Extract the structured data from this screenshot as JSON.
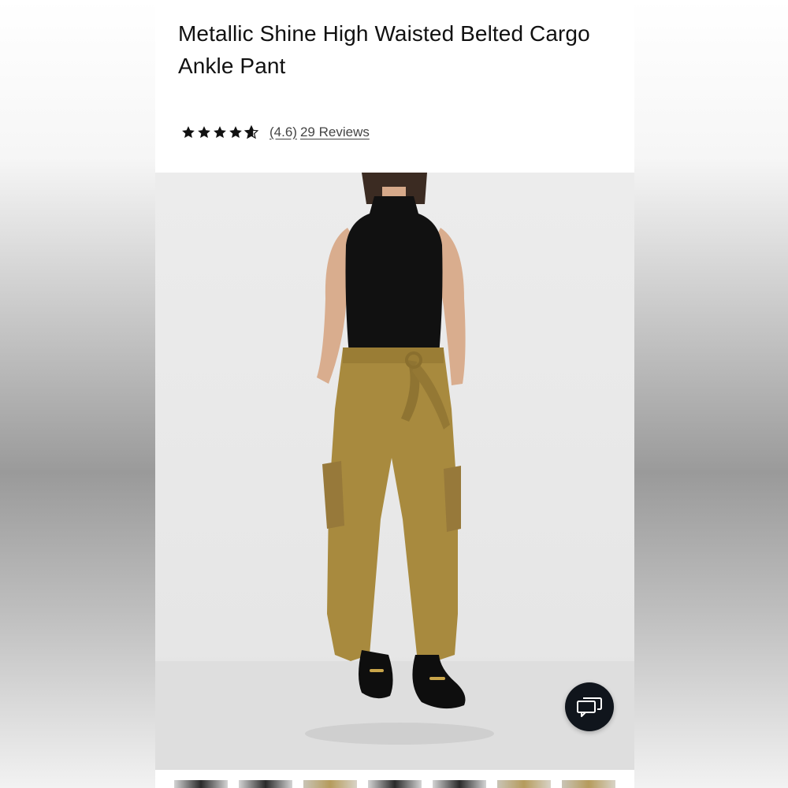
{
  "product": {
    "title": "Metallic Shine High Waisted Belted Cargo Ankle Pant",
    "rating_value": "(4.6)",
    "reviews_text": "29 Reviews",
    "stars": 4.6
  },
  "image": {
    "icon": "product-photo",
    "alt": "Model wearing olive cargo ankle pant with black sleeveless top and black loafers"
  },
  "chat": {
    "icon": "chat-bubbles-icon"
  },
  "thumbnails": [
    "thumb-1",
    "thumb-2",
    "thumb-3",
    "thumb-4",
    "thumb-5",
    "thumb-6",
    "thumb-7"
  ],
  "colors": {
    "text": "#111111",
    "pant": "#a88a3e",
    "chat_bg": "#10151c"
  }
}
